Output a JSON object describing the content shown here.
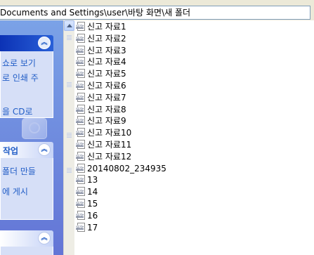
{
  "address_bar": {
    "path": "Documents and Settings\\user\\바탕 화면\\새 폴더"
  },
  "task_pane": {
    "section1": {
      "links": [
        "쇼로 보기",
        "로 인쇄 주",
        "을 CD로"
      ],
      "toggle_icon": "chevron-up-double"
    },
    "section2": {
      "title": "작업",
      "links": [
        "폴더 만들",
        "에 게시"
      ],
      "toggle_icon": "chevron-up-double"
    },
    "section3": {
      "toggle_icon": "chevron-up-double"
    }
  },
  "file_icon": {
    "type": "png-file-icon",
    "tag": "PNG"
  },
  "files": [
    {
      "name": "신고 자료1"
    },
    {
      "name": "신고 자료2"
    },
    {
      "name": "신고 자료3"
    },
    {
      "name": "신고 자료4"
    },
    {
      "name": "신고 자료5"
    },
    {
      "name": "신고 자료6"
    },
    {
      "name": "신고 자료7"
    },
    {
      "name": "신고 자료8"
    },
    {
      "name": "신고 자료9"
    },
    {
      "name": "신고 자료10"
    },
    {
      "name": "신고 자료11"
    },
    {
      "name": "신고 자료12"
    },
    {
      "name": "20140802_234935"
    },
    {
      "name": "13"
    },
    {
      "name": "14"
    },
    {
      "name": "15"
    },
    {
      "name": "16"
    },
    {
      "name": "17"
    }
  ],
  "colors": {
    "taskpane_bg": "#7ba2e7",
    "link": "#215dc6",
    "header_blue": "#0c32b5"
  }
}
